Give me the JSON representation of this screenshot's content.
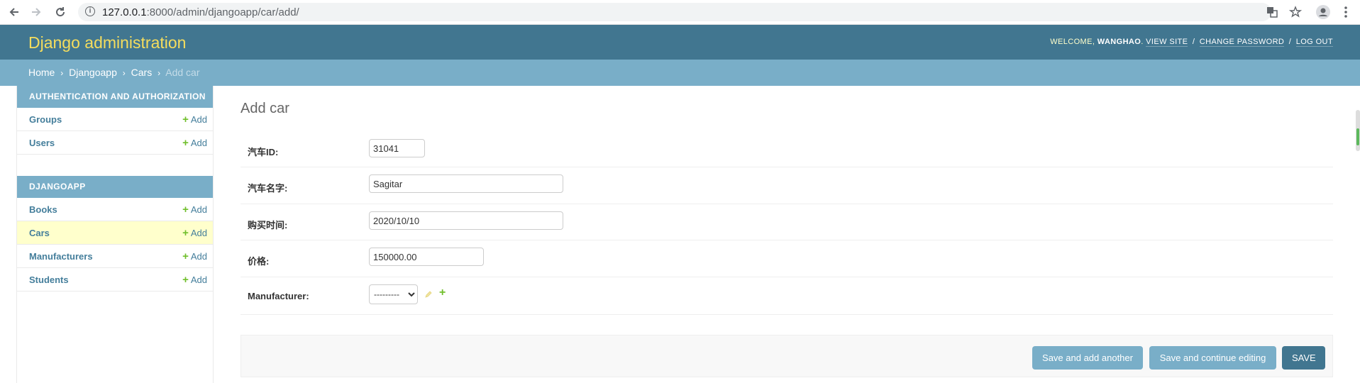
{
  "browser": {
    "url_host": "127.0.0.1",
    "url_path": ":8000/admin/djangoapp/car/add/"
  },
  "header": {
    "branding": "Django administration",
    "welcome": "WELCOME,",
    "username": "WANGHAO",
    "view_site": "VIEW SITE",
    "change_password": "CHANGE PASSWORD",
    "log_out": "LOG OUT"
  },
  "breadcrumbs": {
    "home": "Home",
    "app": "Djangoapp",
    "model": "Cars",
    "current": "Add car"
  },
  "sidebar": {
    "auth_caption": "AUTHENTICATION AND AUTHORIZATION",
    "auth_items": [
      {
        "label": "Groups",
        "add": "Add"
      },
      {
        "label": "Users",
        "add": "Add"
      }
    ],
    "app_caption": "DJANGOAPP",
    "app_items": [
      {
        "label": "Books",
        "add": "Add"
      },
      {
        "label": "Cars",
        "add": "Add"
      },
      {
        "label": "Manufacturers",
        "add": "Add"
      },
      {
        "label": "Students",
        "add": "Add"
      }
    ]
  },
  "content": {
    "title": "Add car",
    "fields": {
      "car_id": {
        "label": "汽车ID:",
        "value": "31041"
      },
      "car_name": {
        "label": "汽车名字:",
        "value": "Sagitar"
      },
      "purchase_time": {
        "label": "购买时间:",
        "value": "2020/10/10"
      },
      "price": {
        "label": "价格:",
        "value": "150000.00"
      },
      "manufacturer": {
        "label": "Manufacturer:",
        "selected": "---------"
      }
    },
    "buttons": {
      "save_add_another": "Save and add another",
      "save_continue": "Save and continue editing",
      "save": "SAVE"
    }
  },
  "colors": {
    "header_bg": "#417690",
    "breadcrumbs_bg": "#79aec8",
    "branding": "#f5dd5d",
    "active_row": "#ffffcc",
    "add_green": "#70bf2b"
  }
}
